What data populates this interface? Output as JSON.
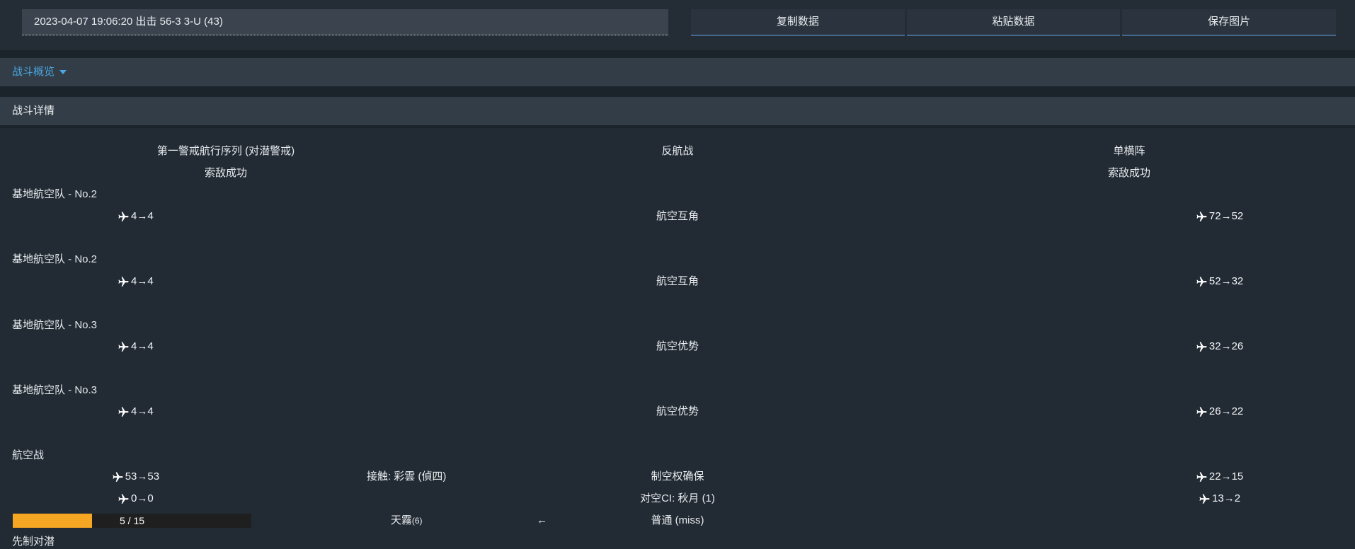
{
  "toolbar": {
    "record_selector_value": "2023-04-07 19:06:20 出击 56-3 3-U (43)",
    "copy_button": "复制数据",
    "paste_button": "粘贴数据",
    "save_button": "保存图片"
  },
  "overview": {
    "label": "战斗概览",
    "caret_icon": "chevron-down"
  },
  "detail": {
    "label": "战斗详情"
  },
  "battle": {
    "header": {
      "friendly_formation": "第一警戒航行序列 (对潜警戒)",
      "engagement": "反航战",
      "enemy_formation": "单横阵",
      "friendly_detection": "索敌成功",
      "enemy_detection": "索敌成功"
    },
    "phases": [
      {
        "title": "基地航空队 - No.2",
        "rows": [
          {
            "left": "4→4",
            "second": "",
            "center": "航空互角",
            "right": "72→52"
          }
        ]
      },
      {
        "title": "基地航空队 - No.2",
        "rows": [
          {
            "left": "4→4",
            "second": "",
            "center": "航空互角",
            "right": "52→32"
          }
        ]
      },
      {
        "title": "基地航空队 - No.3",
        "rows": [
          {
            "left": "4→4",
            "second": "",
            "center": "航空优势",
            "right": "32→26"
          }
        ]
      },
      {
        "title": "基地航空队 - No.3",
        "rows": [
          {
            "left": "4→4",
            "second": "",
            "center": "航空优势",
            "right": "26→22"
          }
        ]
      },
      {
        "title": "航空战",
        "rows": [
          {
            "left": "53→53",
            "second": "接触: 彩雲 (偵四)",
            "center": "制空权确保",
            "right": "22→15"
          },
          {
            "left": "0→0",
            "second": "",
            "center": "对空CI: 秋月 (1)",
            "right": "13→2"
          }
        ],
        "attack": {
          "hp_current": 5,
          "hp_max": 15,
          "hp_label": "5 / 15",
          "target": "天霧",
          "target_index": "(6)",
          "arrow": "←",
          "result": "普通 (miss)"
        }
      },
      {
        "title": "先制对潜"
      }
    ]
  },
  "colors": {
    "accent_blue": "#4aa7e1",
    "hp_bar_fill": "#f5a623",
    "hp_bar_track": "#1f1f1f",
    "button_underline": "#44688e"
  }
}
